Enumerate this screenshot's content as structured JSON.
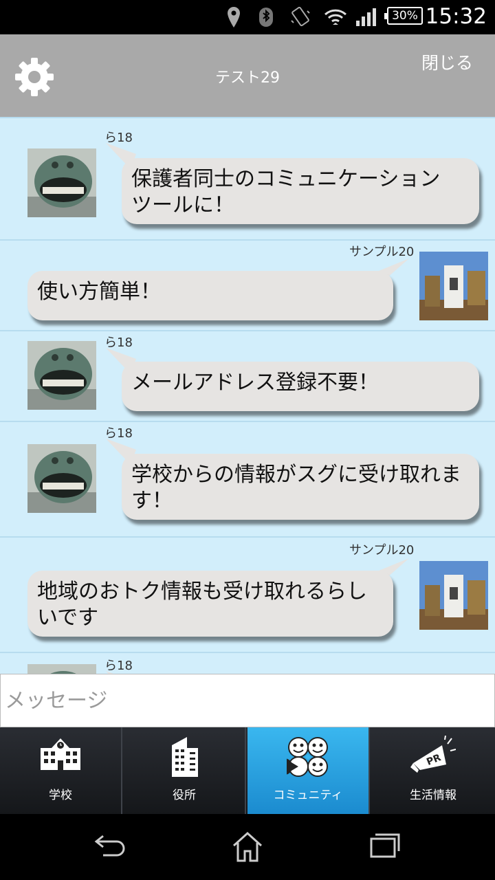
{
  "status_bar": {
    "time": "15:32",
    "battery": "30%"
  },
  "header": {
    "title": "テスト29",
    "close_label": "閉じる"
  },
  "messages": [
    {
      "side": "left",
      "user": "ら18",
      "text_lines": [
        "保護者同士のコミュニケーション",
        "ツールに！"
      ]
    },
    {
      "side": "right",
      "user": "サンプル20",
      "text_lines": [
        "使い方簡単！"
      ]
    },
    {
      "side": "left",
      "user": "ら18",
      "text_lines": [
        "メールアドレス登録不要！"
      ]
    },
    {
      "side": "left",
      "user": "ら18",
      "text_lines": [
        "学校からの情報がスグに受け取れま",
        "す！"
      ]
    },
    {
      "side": "right",
      "user": "サンプル20",
      "text_lines": [
        "地域のおトク情報も受け取れるらし",
        "いです"
      ]
    },
    {
      "side": "left",
      "user": "ら18",
      "text_lines": []
    }
  ],
  "input": {
    "placeholder": "メッセージ"
  },
  "tabs": [
    {
      "label": "学校",
      "icon": "school-icon",
      "active": false
    },
    {
      "label": "役所",
      "icon": "office-building-icon",
      "active": false
    },
    {
      "label": "コミュニティ",
      "icon": "community-faces-icon",
      "active": true
    },
    {
      "label": "生活情報",
      "icon": "pr-megaphone-icon",
      "active": false
    }
  ],
  "colors": {
    "header": "#a9a9a9",
    "chat_bg": "#d2eefb",
    "bubble": "#e6e4e2",
    "tab_active": "#2aa3e0",
    "tab_bg": "#1f2227"
  }
}
